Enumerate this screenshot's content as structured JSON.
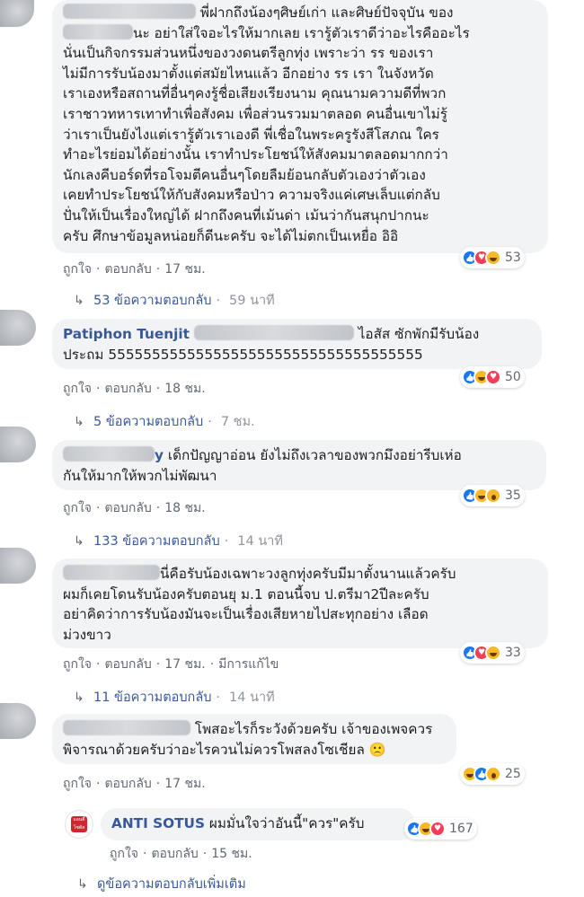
{
  "colors": {
    "link": "#385898",
    "bubble": "#f2f3f5",
    "meta": "#606770",
    "like": "#1877f2",
    "love": "#f33e58",
    "yellow": "#f7b928"
  },
  "common": {
    "like": "ถูกใจ",
    "reply": "ตอบกลับ",
    "dot": "·"
  },
  "comments": [
    {
      "name": "",
      "lines": [
        "พี่ฝากถึงน้องๆศิษย์เก่า และศิษย์ปัจจุบัน ของ",
        "นะ อย่าใส่ใจอะไรให้มากเลย เรารู้ตัวเราดีว่าอะไรคืออะไร",
        "นั่นเป็นกิจกรรมส่วนหนึ่งของวงดนตรีลูกทุ่ง เพราะว่า รร ของเรา",
        "ไม่มีการรับน้องมาตั้งแต่สมัยไหนแล้ว อีกอย่าง รร เรา ในจังหวัด",
        "เราเองหรือสถานที่อื่นๆคงรู้ชื่อเสียงเรียงนาม คุณนามความดีที่พวก",
        "เราชาวทหารเทาทำเพื่อสังคม เพื่อส่วนรวมมาตลอด คนอื่นเขาไม่รู้",
        "ว่าเราเป็นยังไงแต่เรารู้ตัวเราเองดี พี่เชื่อในพระครูรังสีโสภณ ใคร",
        "ทำอะไรย่อมได้อย่างนั้น เราทำประโยชน์ให้สังคมมาตลอดมากกว่า",
        "นักเลงคีบอร์ดที่รอโจมตีคนอื่นๆโดยลืมย้อนกลับตัวเองว่าตัวเอง",
        "เคยทำประโยชน์ให้กับสังคมหรือป่าว ความจริงแค่เศษเล็บแต่กลับ",
        "ปั่นให้เป็นเรื่องใหญ่ได้ ฝากถึงคนที่เม้นด่า เม้นว่ากันสนุกปากนะ",
        "ครับ ศึกษาข้อมูลหน่อยก็ดีนะครับ จะได้ไม่ตกเป็นเหยื่อ อิอิ"
      ],
      "time": "17 ชม.",
      "reactions": [
        "like",
        "love",
        "haha"
      ],
      "reaction_count": "53",
      "replies_label": "53 ข้อความตอบกลับ",
      "replies_time": "59 นาที"
    },
    {
      "name": "Patiphon Tuenjit",
      "lines": [
        "ไอสัส ซักพักมีรับน้อง",
        "ประถม 555555555555555555555555555555555555"
      ],
      "time": "18 ชม.",
      "reactions": [
        "like",
        "haha",
        "love"
      ],
      "reaction_count": "50",
      "replies_label": "5 ข้อความตอบกลับ",
      "replies_time": "7 ชม."
    },
    {
      "name": "y",
      "lines": [
        "เด็กปัญญาอ่อน ยังไม่ถึงเวลาของพวกมึงอย่ารีบเห่อ",
        "กันให้มากให้พวกไม่พัฒนา"
      ],
      "time": "18 ชม.",
      "reactions": [
        "like",
        "haha",
        "wow"
      ],
      "reaction_count": "35",
      "replies_label": "133 ข้อความตอบกลับ",
      "replies_time": "14 นาที"
    },
    {
      "name": "",
      "lines": [
        "นี่คือรับน้องเฉพาะวงลูกทุ่งครับมีมาตั้งนานแล้วครับ",
        "ผมก็เคยโดนรับน้องครับตอนยุ ม.1 ตอนนี้จบ ป.ตรีมา2ปีละครับ",
        "อย่าคิดว่าการรับน้องมันจะเป็นเรื่องเสียหายไปสะทุกอย่าง เลือด",
        "ม่วงขาว"
      ],
      "time": "17 ชม.",
      "edited": "มีการแก้ไข",
      "reactions": [
        "like",
        "love",
        "haha"
      ],
      "reaction_count": "33",
      "replies_label": "11 ข้อความตอบกลับ",
      "replies_time": "14 นาที"
    },
    {
      "name": "",
      "lines": [
        "โพสอะไรก็ระวังด้วยครับ เจ้าของเพจควร",
        "พิจารณาด้วยครับว่าอะไรควนไม่ควรโพสลงโซเชียล 🙁"
      ],
      "time": "17 ชม.",
      "reactions": [
        "haha",
        "like",
        "wow"
      ],
      "reaction_count": "25"
    }
  ],
  "reply": {
    "name": "ANTI SOTUS",
    "text": "ผมมั่นใจว่าอันนี้\"ควร\"ครับ",
    "time": "15 ชม.",
    "reactions": [
      "like",
      "haha",
      "love"
    ],
    "reaction_count": "167",
    "brand_text": "แอนตี้ โซตัส"
  },
  "more_replies": "ดูข้อความตอบกลับเพิ่มเติม"
}
